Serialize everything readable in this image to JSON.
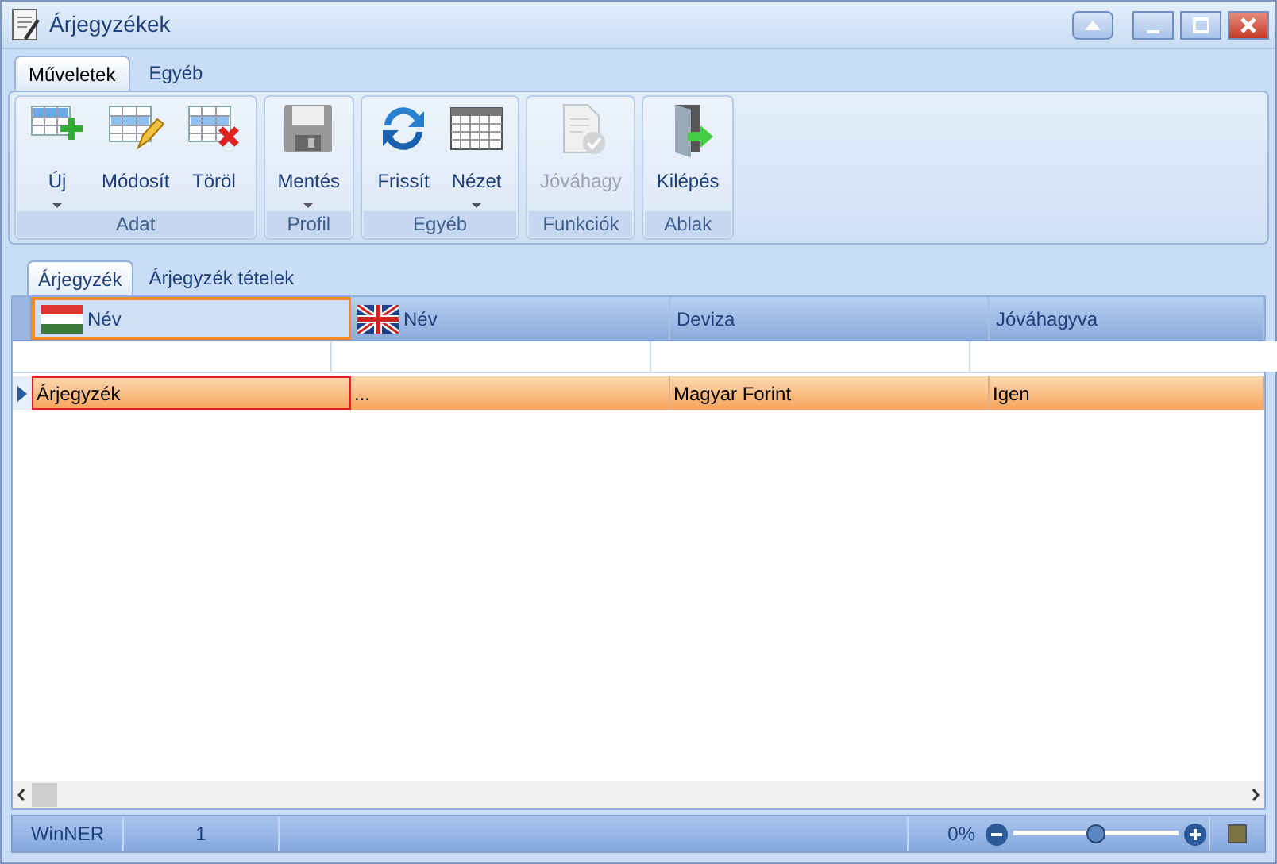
{
  "window": {
    "title": "Árjegyzékek"
  },
  "ribbon": {
    "tabs": [
      {
        "label": "Műveletek",
        "selected": true
      },
      {
        "label": "Egyéb",
        "selected": false
      }
    ],
    "groups": [
      {
        "label": "Adat",
        "buttons": [
          {
            "label": "Új",
            "kind": "grid-add",
            "dropdown": true,
            "disabled": false
          },
          {
            "label": "Módosít",
            "kind": "grid-edit",
            "dropdown": false,
            "disabled": false
          },
          {
            "label": "Töröl",
            "kind": "grid-delete",
            "dropdown": false,
            "disabled": false
          }
        ]
      },
      {
        "label": "Profil",
        "buttons": [
          {
            "label": "Mentés",
            "kind": "save",
            "dropdown": true,
            "disabled": false
          }
        ]
      },
      {
        "label": "Egyéb",
        "buttons": [
          {
            "label": "Frissít",
            "kind": "refresh",
            "dropdown": false,
            "disabled": false
          },
          {
            "label": "Nézet",
            "kind": "table",
            "dropdown": true,
            "disabled": false
          }
        ]
      },
      {
        "label": "Funkciók",
        "buttons": [
          {
            "label": "Jóváhagy",
            "kind": "approve",
            "dropdown": false,
            "disabled": true
          }
        ]
      },
      {
        "label": "Ablak",
        "buttons": [
          {
            "label": "Kilépés",
            "kind": "exit",
            "dropdown": false,
            "disabled": false
          }
        ]
      }
    ]
  },
  "doc_tabs": [
    {
      "label": "Árjegyzék",
      "selected": true
    },
    {
      "label": "Árjegyzék tételek",
      "selected": false
    }
  ],
  "grid": {
    "columns": [
      {
        "label": "Név",
        "kind": "flag-hu",
        "focused": true
      },
      {
        "label": "Név",
        "kind": "flag-gb",
        "focused": false
      },
      {
        "label": "Deviza",
        "focused": false
      },
      {
        "label": "Jóváhagyva",
        "focused": false
      }
    ],
    "rows": [
      {
        "selected": true,
        "cells": [
          {
            "text": "Árjegyzék",
            "focused": true
          },
          {
            "text": "...",
            "focused": false
          },
          {
            "text": "Magyar Forint",
            "focused": false
          },
          {
            "text": "Igen",
            "focused": false
          }
        ]
      }
    ]
  },
  "status_bar": {
    "app": "WinNER",
    "count": "1",
    "zoom": "0%",
    "zoom_level": {
      "level": 0.5
    }
  }
}
